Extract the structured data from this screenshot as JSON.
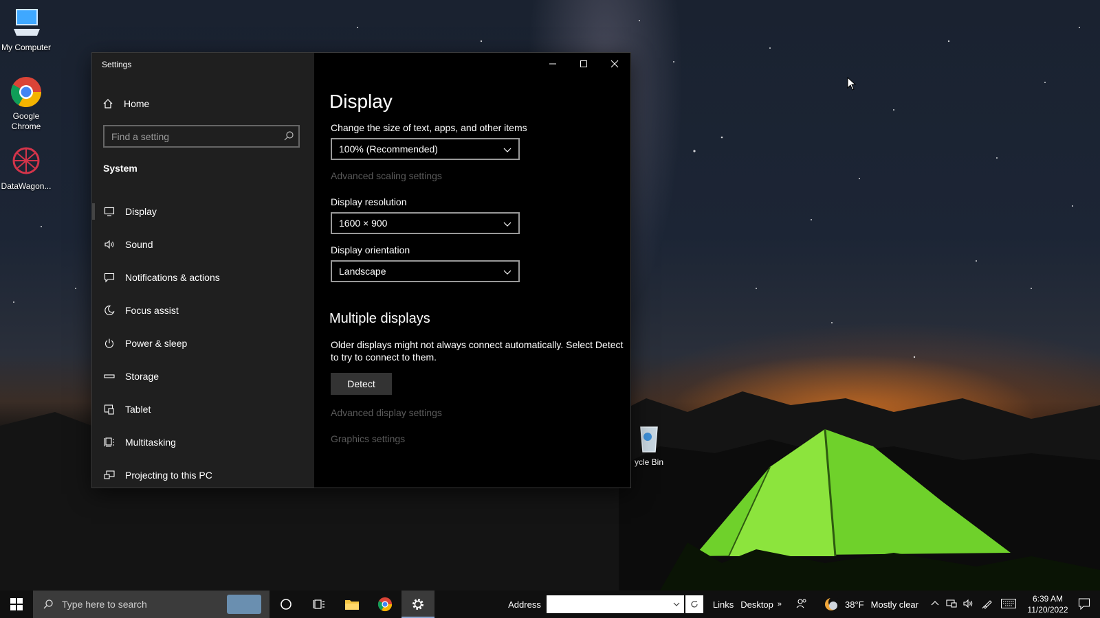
{
  "desktop": {
    "icons": [
      {
        "label": "My Computer"
      },
      {
        "label": "Google Chrome"
      },
      {
        "label": "DataWagon..."
      },
      {
        "label": "ycle Bin"
      }
    ]
  },
  "window": {
    "title": "Settings",
    "controls": {
      "minimize": "minimize",
      "maximize": "maximize",
      "close": "close"
    }
  },
  "sidebar": {
    "home_label": "Home",
    "search_placeholder": "Find a setting",
    "section_title": "System",
    "items": [
      {
        "label": "Display",
        "icon": "monitor-icon",
        "active": true
      },
      {
        "label": "Sound",
        "icon": "speaker-icon"
      },
      {
        "label": "Notifications & actions",
        "icon": "notification-icon"
      },
      {
        "label": "Focus assist",
        "icon": "moon-icon"
      },
      {
        "label": "Power & sleep",
        "icon": "power-icon"
      },
      {
        "label": "Storage",
        "icon": "storage-icon"
      },
      {
        "label": "Tablet",
        "icon": "tablet-icon"
      },
      {
        "label": "Multitasking",
        "icon": "multitasking-icon"
      },
      {
        "label": "Projecting to this PC",
        "icon": "projecting-icon"
      }
    ]
  },
  "content": {
    "heading": "Display",
    "scale_label": "Change the size of text, apps, and other items",
    "scale_value": "100% (Recommended)",
    "advanced_scaling_link": "Advanced scaling settings",
    "resolution_label": "Display resolution",
    "resolution_value": "1600 × 900",
    "orientation_label": "Display orientation",
    "orientation_value": "Landscape",
    "multiple_heading": "Multiple displays",
    "multiple_desc": "Older displays might not always connect automatically. Select Detect to try to connect to them.",
    "detect_label": "Detect",
    "advanced_display_link": "Advanced display settings",
    "graphics_link": "Graphics settings"
  },
  "taskbar": {
    "search_placeholder": "Type here to search",
    "address_label": "Address",
    "links_label": "Links",
    "desktop_label": "Desktop",
    "weather_temp": "38°F",
    "weather_desc": "Mostly clear",
    "time": "6:39 AM",
    "date": "11/20/2022"
  },
  "colors": {
    "sidebar_bg": "#1f1f1f",
    "content_bg": "#000000",
    "link_disabled": "#5a5a5a",
    "taskbar_bg": "#101010"
  }
}
